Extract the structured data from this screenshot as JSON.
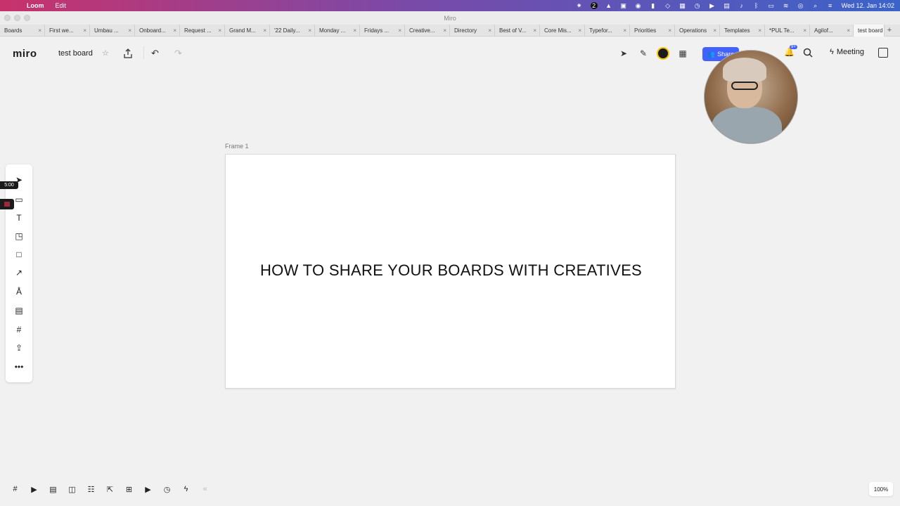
{
  "menubar": {
    "app": "Loom",
    "menu_edit": "Edit",
    "clock": "Wed 12. Jan  14:02",
    "badge_num": "2"
  },
  "window": {
    "title": "Miro"
  },
  "tabs": [
    "Boards",
    "First we...",
    "Umbau ...",
    "Onboard...",
    "Request ...",
    "Grand M...",
    "'22 Daily...",
    "Monday ...",
    "Fridays ...",
    "Creative...",
    "Directory",
    "Best of V...",
    "Core Mis...",
    "Typefor...",
    "Priorities",
    "Operations",
    "Templates",
    "*PUL Te...",
    "Agilof...",
    "test board"
  ],
  "header": {
    "logo": "miro",
    "board_name": "test board",
    "share_label": "Share",
    "meeting_label": "Meeting",
    "notif_count": "9+"
  },
  "frame": {
    "label": "Frame 1",
    "text": "HOW TO SHARE YOUR BOARDS WITH CREATIVES"
  },
  "recorder": {
    "timer": "5:00"
  },
  "zoom": {
    "level": "100%"
  }
}
